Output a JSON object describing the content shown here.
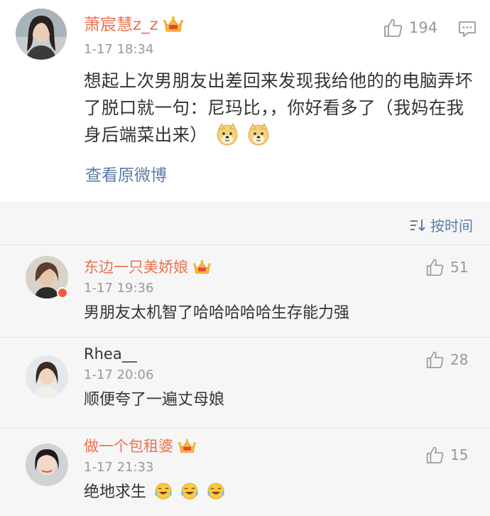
{
  "post": {
    "username": "萧宸慧z_z",
    "time": "1-17 18:34",
    "like_count": "194",
    "text": "想起上次男朋友出差回来发现我给他的的电脑弄坏了脱口就一句：尼玛比，，你好看多了（我妈在我身后端菜出来）",
    "emojis": [
      "doge",
      "doge"
    ],
    "view_original": "查看原微博"
  },
  "comments_header": {
    "sort_label": "按时间"
  },
  "comments": [
    {
      "username": "东边一只美娇娘",
      "time": "1-17 19:36",
      "text": "男朋友太机智了哈哈哈哈哈生存能力强",
      "like_count": "51",
      "vip": true
    },
    {
      "username": "Rhea__",
      "time": "1-17 20:06",
      "text": "顺便夸了一遍丈母娘",
      "like_count": "28",
      "vip": false
    },
    {
      "username": "做一个包租婆",
      "time": "1-17 21:33",
      "text": "绝地求生",
      "like_count": "15",
      "vip": true,
      "emojis": [
        "laugh-cry",
        "laugh-cry",
        "laugh-cry"
      ]
    }
  ],
  "colors": {
    "username_orange": "#eb7350",
    "link_blue": "#5b7caa",
    "meta_gray": "#999999",
    "comments_bg": "#f6f6f6"
  }
}
